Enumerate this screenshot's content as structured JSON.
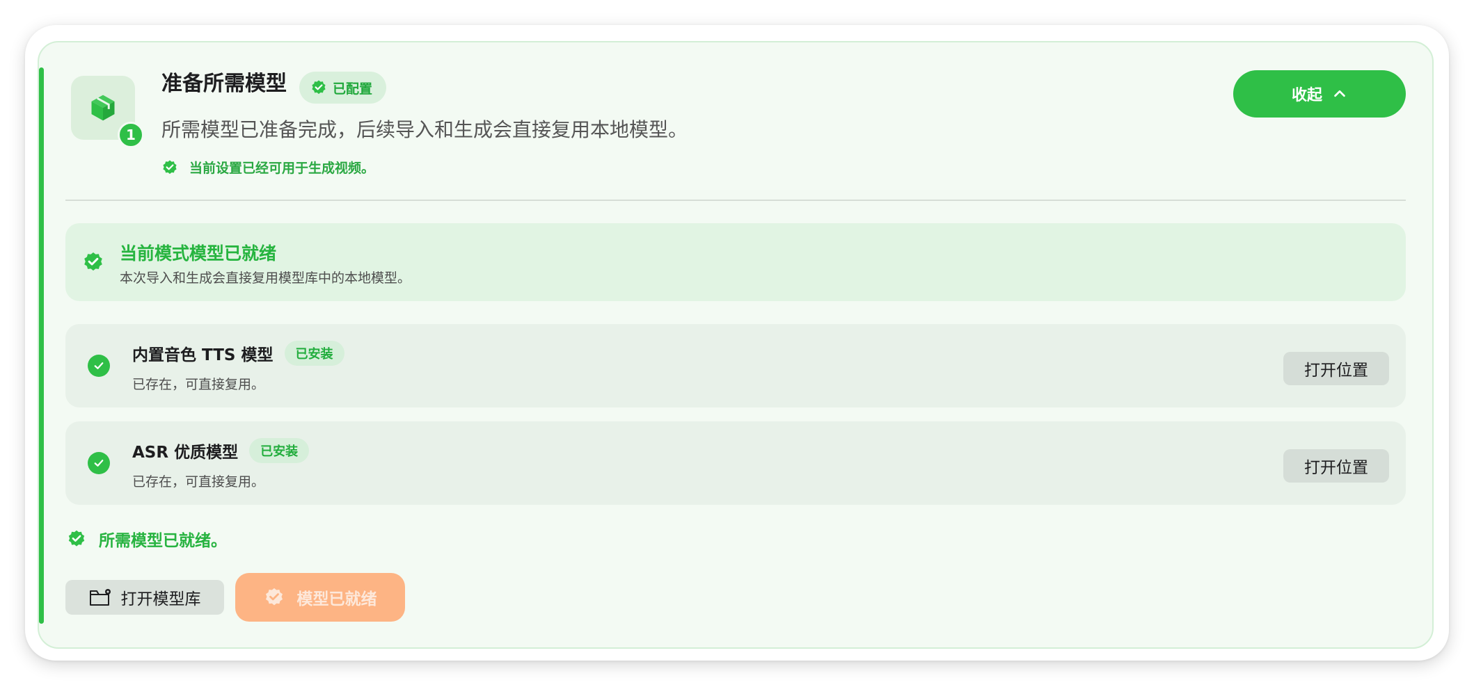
{
  "header": {
    "step_number": "1",
    "title": "准备所需模型",
    "configured_badge": "已配置",
    "subtitle": "所需模型已准备完成，后续导入和生成会直接复用本地模型。",
    "note": "当前设置已经可用于生成视频。",
    "collapse_label": "收起"
  },
  "banner": {
    "title": "当前模式模型已就绪",
    "description": "本次导入和生成会直接复用模型库中的本地模型。"
  },
  "models": [
    {
      "name": "内置音色 TTS 模型",
      "badge": "已安装",
      "status": "已存在，可直接复用。",
      "action": "打开位置"
    },
    {
      "name": "ASR 优质模型",
      "badge": "已安装",
      "status": "已存在，可直接复用。",
      "action": "打开位置"
    }
  ],
  "footer": {
    "note": "所需模型已就绪。",
    "open_library_label": "打开模型库",
    "ready_label": "模型已就绪"
  },
  "colors": {
    "accent_green": "#2fbf47",
    "card_bg": "#f3faf3",
    "ready_button": "#fdb484"
  },
  "icons": {
    "step": "package-icon",
    "configured": "verified-badge-icon",
    "check": "check-circle-icon",
    "collapse": "chevron-up-icon",
    "library": "folder-settings-icon"
  }
}
